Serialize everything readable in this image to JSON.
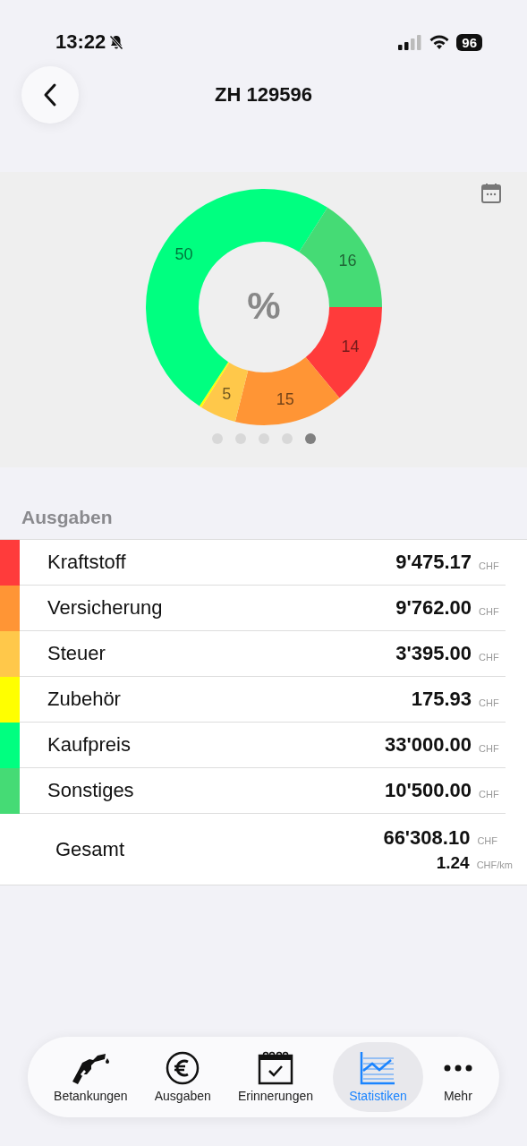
{
  "status_bar": {
    "time": "13:22",
    "battery": "96"
  },
  "nav": {
    "title": "ZH 129596"
  },
  "chart_panel": {
    "center_label": "%",
    "page_dots": [
      {
        "selected": false
      },
      {
        "selected": false
      },
      {
        "selected": false
      },
      {
        "selected": false
      },
      {
        "selected": true
      }
    ],
    "chart_data": {
      "type": "donut",
      "values": [
        14,
        15,
        5,
        0.3,
        50,
        16
      ],
      "value_labels": [
        "14",
        "15",
        "5",
        null,
        "50",
        "16"
      ],
      "colors": [
        "#ff3b3b",
        "#ff9535",
        "#ffc84a",
        "#ffff00",
        "#00ff80",
        "#45db75"
      ]
    }
  },
  "expenses": {
    "header": "Ausgaben",
    "rows": [
      {
        "label": "Kraftstoff",
        "amount": "9'475.17",
        "unit": "CHF",
        "color": "#ff3b3b"
      },
      {
        "label": "Versicherung",
        "amount": "9'762.00",
        "unit": "CHF",
        "color": "#ff9535"
      },
      {
        "label": "Steuer",
        "amount": "3'395.00",
        "unit": "CHF",
        "color": "#ffc84a"
      },
      {
        "label": "Zubehör",
        "amount": "175.93",
        "unit": "CHF",
        "color": "#ffff00"
      },
      {
        "label": "Kaufpreis",
        "amount": "33'000.00",
        "unit": "CHF",
        "color": "#00ff80"
      },
      {
        "label": "Sonstiges",
        "amount": "10'500.00",
        "unit": "CHF",
        "color": "#45db75"
      }
    ],
    "total": {
      "label": "Gesamt",
      "amount": "66'308.10",
      "unit": "CHF",
      "per_km": "1.24",
      "per_km_unit": "CHF/km"
    }
  },
  "tab_bar": [
    {
      "label": "Betankungen",
      "selected": false
    },
    {
      "label": "Ausgaben",
      "selected": false
    },
    {
      "label": "Erinnerungen",
      "selected": false
    },
    {
      "label": "Statistiken",
      "selected": true
    },
    {
      "label": "Mehr",
      "selected": false
    }
  ]
}
